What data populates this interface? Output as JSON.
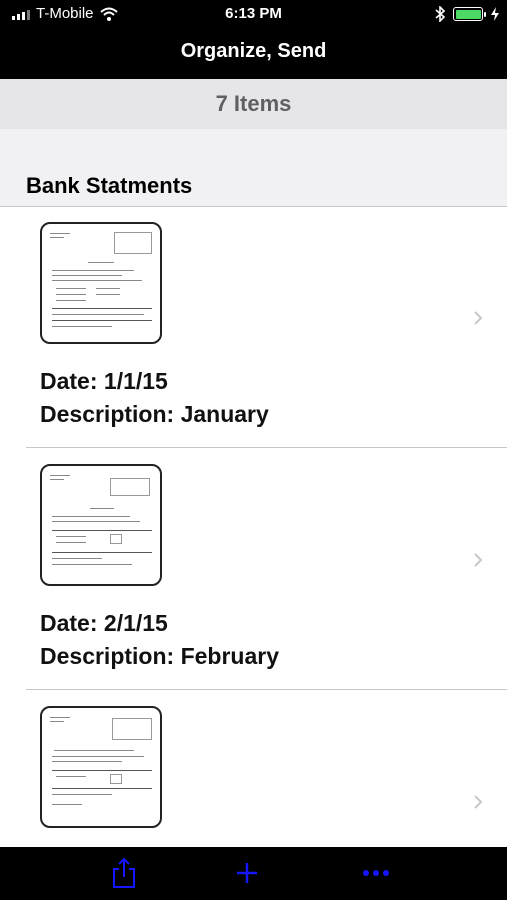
{
  "status_bar": {
    "carrier": "T-Mobile",
    "time": "6:13 PM"
  },
  "nav": {
    "title": "Organize, Send"
  },
  "items_header": {
    "text": "7 Items"
  },
  "section": {
    "title": "Bank Statments"
  },
  "rows": [
    {
      "date": "Date: 1/1/15",
      "description": "Description: January"
    },
    {
      "date": "Date: 2/1/15",
      "description": "Description: February"
    },
    {
      "date": "",
      "description": ""
    }
  ],
  "toolbar": {
    "icons": [
      "share-icon",
      "plus-icon",
      "more-icon"
    ],
    "accent": "#1515ff"
  },
  "colors": {
    "bar": "#000000",
    "battery": "#4cd964",
    "header_bg": "#e6e6e9"
  }
}
